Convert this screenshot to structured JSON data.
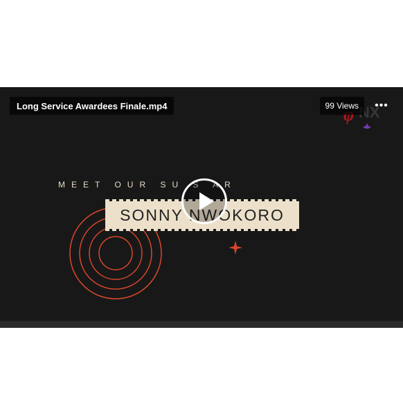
{
  "video": {
    "title": "Long Service Awardees Finale.mp4",
    "views": "99 Views",
    "more_icon": "more-horizontal-icon",
    "play_icon": "play-icon"
  },
  "frame": {
    "tagline": "MEET OUR SU     S AR",
    "name": "SONNY NWOKORO",
    "watermark_text": "NX"
  },
  "colors": {
    "background": "#181818",
    "accent": "#d9472b",
    "name_plate": "#ece0ca"
  }
}
